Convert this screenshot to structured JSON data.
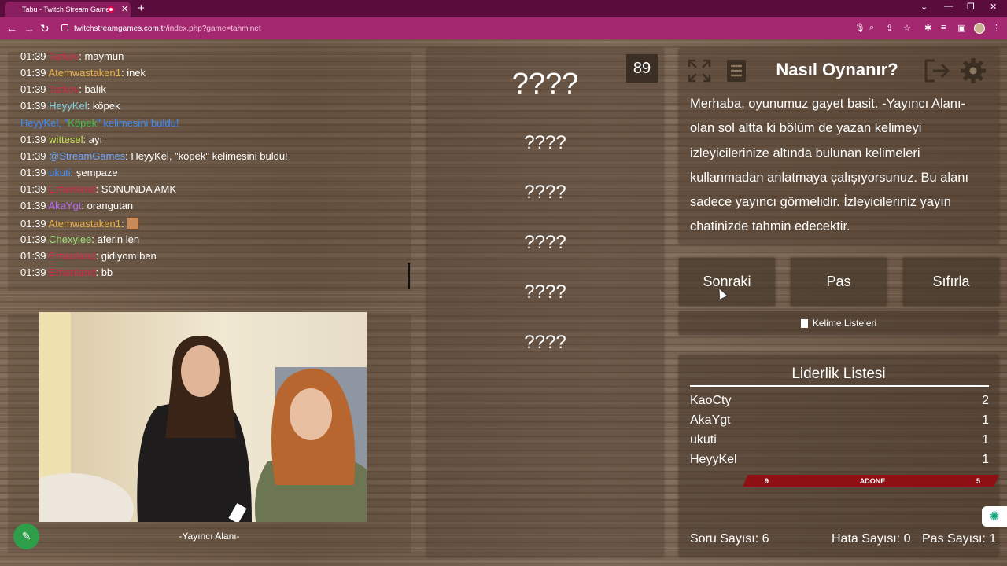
{
  "browser": {
    "tab_title": "Tabu - Twitch Stream Games",
    "tab_close": "✕",
    "new_tab": "+",
    "url_host": "twitchstreamgames.com.tr",
    "url_path": "/index.php?game=tahminet"
  },
  "chat": {
    "lines": [
      {
        "time": "01:39",
        "user": "Tarkov",
        "user_color": "#d22a4a",
        "text": "maymun"
      },
      {
        "time": "01:39",
        "user": "Atemwastaken1",
        "user_color": "#e8b24a",
        "text": "inek"
      },
      {
        "time": "01:39",
        "user": "Tarkov",
        "user_color": "#d22a4a",
        "text": "balık"
      },
      {
        "time": "01:39",
        "user": "HeyyKel",
        "user_color": "#7fd3e6",
        "text": "köpek"
      },
      {
        "time": "",
        "user": "HeyyKel",
        "user_color": "#3b8cff",
        "system_a": ", \"",
        "system_word": "Köpek",
        "system_b": "\" kelimesini buldu!"
      },
      {
        "time": "01:39",
        "user": "wittesel",
        "user_color": "#c8e65a",
        "text": "ayı"
      },
      {
        "time": "01:39",
        "user": "@StreamGames",
        "user_color": "#6ea8ff",
        "text": "HeyyKel, \"köpek\" kelimesini buldu!"
      },
      {
        "time": "01:39",
        "user": "ukuti",
        "user_color": "#3b8cff",
        "text": "şempaze"
      },
      {
        "time": "01:39",
        "user": "Erhanland",
        "user_color": "#d22a4a",
        "text": "SONUNDA AMK"
      },
      {
        "time": "01:39",
        "user": "AkaYgt",
        "user_color": "#b86bff",
        "text": "orangutan"
      },
      {
        "time": "01:39",
        "user": "Atemwastaken1",
        "user_color": "#e8b24a",
        "text": ""
      },
      {
        "time": "01:39",
        "user": "Chexyiee",
        "user_color": "#9be07a",
        "text": "aferin len"
      },
      {
        "time": "01:39",
        "user": "Erhanland",
        "user_color": "#d22a4a",
        "text": "gidiyom ben"
      },
      {
        "time": "01:39",
        "user": "Erhanland",
        "user_color": "#d22a4a",
        "text": "bb"
      }
    ]
  },
  "streamer": {
    "caption": "-Yayıncı Alanı-"
  },
  "game": {
    "timer": "89",
    "main_word": "????",
    "taboo_words": [
      "????",
      "????",
      "????",
      "????",
      "????"
    ]
  },
  "howto": {
    "title": "Nasıl Oynanır?",
    "text": "Merhaba, oyunumuz gayet basit. -Yayıncı Alanı- olan sol altta ki bölüm de yazan kelimeyi izleyicilerinize altında bulunan kelimeleri kullanmadan anlatmaya çalışıyorsunuz. Bu alanı sadece yayıncı görmelidir. İzleyicileriniz yayın chatinizde tahmin edecektir."
  },
  "actions": {
    "next": "Sonraki",
    "pass": "Pas",
    "reset": "Sıfırla"
  },
  "word_lists": "Kelime Listeleri",
  "leaderboard": {
    "title": "Liderlik Listesi",
    "rows": [
      {
        "name": "KaoCty",
        "score": "2"
      },
      {
        "name": "AkaYgt",
        "score": "1"
      },
      {
        "name": "ukuti",
        "score": "1"
      },
      {
        "name": "HeyyKel",
        "score": "1"
      }
    ]
  },
  "adone_bar": {
    "left": "9",
    "label": "ADONE",
    "right": "5"
  },
  "stats": {
    "questions": "Soru Sayısı: 6",
    "errors": "Hata Sayısı: 0",
    "passes": "Pas Sayısı: 1"
  },
  "icons": [
    "fullscreen-icon",
    "notes-icon",
    "exit-icon",
    "settings-icon",
    "pen-icon",
    "chatgpt-icon"
  ]
}
